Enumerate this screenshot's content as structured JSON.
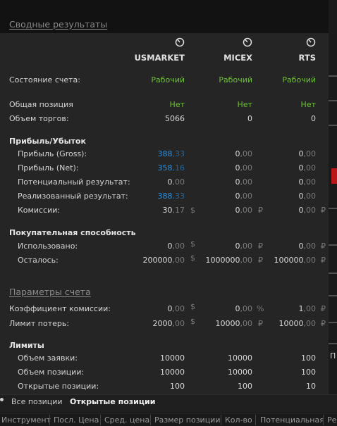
{
  "summary_title": "Сводные результаты",
  "columns": [
    {
      "name": "USMARKET",
      "icon": "gauge-icon"
    },
    {
      "name": "MICEX",
      "icon": "gauge-icon"
    },
    {
      "name": "RTS",
      "icon": "gauge-icon"
    }
  ],
  "account_state": {
    "label": "Состояние счета:",
    "values": [
      "Рабочий",
      "Рабочий",
      "Рабочий"
    ]
  },
  "general_position": {
    "label": "Общая позиция",
    "values": [
      "Нет",
      "Нет",
      "Нет"
    ]
  },
  "trade_volume": {
    "label": "Объем торгов:",
    "values": [
      "5066",
      "0",
      "0"
    ]
  },
  "pnl": {
    "heading": "Прибыль/Убыток",
    "gross": {
      "label": "Прибыль (Gross):",
      "values": [
        [
          "388",
          ",33"
        ],
        [
          "0",
          ",00"
        ],
        [
          "0",
          ",00"
        ]
      ]
    },
    "net": {
      "label": "Прибыль (Net):",
      "values": [
        [
          "358",
          ",16"
        ],
        [
          "0",
          ",00"
        ],
        [
          "0",
          ",00"
        ]
      ]
    },
    "potential": {
      "label": "Потенциальный результат:",
      "values": [
        [
          "0",
          ",00"
        ],
        [
          "0",
          ",00"
        ],
        [
          "0",
          ",00"
        ]
      ]
    },
    "realized": {
      "label": "Реализованный результат:",
      "values": [
        [
          "388",
          ",33"
        ],
        [
          "0",
          ",00"
        ],
        [
          "0",
          ",00"
        ]
      ]
    },
    "commissions": {
      "label": "Комиссии:",
      "values": [
        [
          "30",
          ",17"
        ],
        [
          "0",
          ",00"
        ],
        [
          "0",
          ",00"
        ]
      ],
      "units": [
        "$",
        "₽",
        "₽"
      ]
    }
  },
  "buying_power": {
    "heading": "Покупательная способность",
    "used": {
      "label": "Использовано:",
      "values": [
        [
          "0",
          ",00"
        ],
        [
          "0",
          ",00"
        ],
        [
          "0",
          ",00"
        ]
      ],
      "units": [
        "$",
        "₽",
        "₽"
      ]
    },
    "remaining": {
      "label": "Осталось:",
      "values": [
        [
          "200000",
          ",00"
        ],
        [
          "1000000",
          ",00"
        ],
        [
          "100000",
          ",00"
        ]
      ],
      "units": [
        "$",
        "₽",
        "₽"
      ]
    }
  },
  "account_params": {
    "title": "Параметры счета",
    "commission_rate": {
      "label": "Коэффициент комиссии:",
      "values": [
        [
          "0",
          ",00"
        ],
        [
          "0",
          ",00"
        ],
        [
          "1",
          ",00"
        ]
      ],
      "units": [
        "$",
        "%",
        "₽"
      ]
    },
    "loss_limit": {
      "label": "Лимит потерь:",
      "values": [
        [
          "2000",
          ",00"
        ],
        [
          "10000",
          ",00"
        ],
        [
          "10000",
          ",00"
        ]
      ],
      "units": [
        "$",
        "₽",
        "₽"
      ]
    }
  },
  "limits": {
    "heading": "Лимиты",
    "order_volume": {
      "label": "Объем заявки:",
      "values": [
        "10000",
        "10000",
        "100"
      ]
    },
    "position_volume": {
      "label": "Объем позиции:",
      "values": [
        "10000",
        "10000",
        "100"
      ]
    },
    "open_positions": {
      "label": "Открытые позиции:",
      "values": [
        "100",
        "100",
        "10"
      ]
    }
  },
  "tabs": [
    {
      "label": "Все позиции",
      "active": false
    },
    {
      "label": "Открытые позиции",
      "active": true
    }
  ],
  "table_headers": [
    "Инструмент",
    "Посл. Цена",
    "Сред. цена",
    "Размер позиции",
    "Кол-во",
    "Потенциальная",
    "Ре"
  ],
  "edge_glyph": "П",
  "colors": {
    "green": "#6fbf3a",
    "blue": "#2f8fdc",
    "panel": "#252525"
  }
}
